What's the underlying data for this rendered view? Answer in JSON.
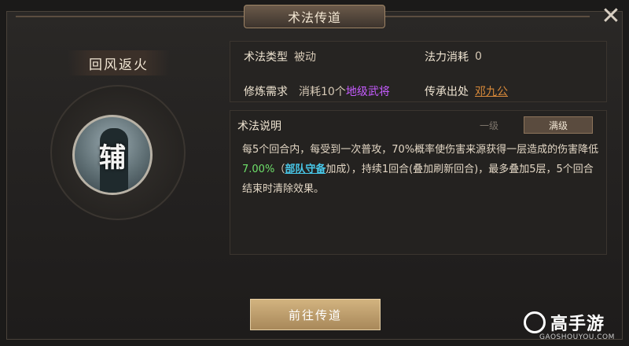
{
  "window": {
    "title": "术法传道",
    "close_icon": "close-icon"
  },
  "skill": {
    "name": "回风返火",
    "portrait_char": "辅"
  },
  "info": {
    "type_label": "术法类型",
    "type_value": "被动",
    "mana_label": "法力消耗",
    "mana_value": "0",
    "train_label": "修炼需求",
    "train_prefix": "消耗10个",
    "train_item": "地级武将",
    "source_label": "传承出处",
    "source_value": "邓九公"
  },
  "description": {
    "title": "术法说明",
    "tabs": {
      "level1": "一级",
      "max": "满级"
    },
    "seg1": "每5个回合内，每受到一次普攻，70%概率使伤害来源获得一层造成的伤害降低",
    "value": "7.00%",
    "seg2": "（",
    "link": "部队守备",
    "seg3": "加成），持续1回合(叠加刷新回合)，最多叠加5层，5个回合结束时清除效果。"
  },
  "buttons": {
    "go": "前往传道"
  },
  "watermark": {
    "name": "高手游",
    "url": "GAOSHOUYOU.COM"
  },
  "colors": {
    "green": "#6ee06a",
    "link": "#48c7e8",
    "purple": "#c65cff",
    "button": "#c2a06c"
  }
}
